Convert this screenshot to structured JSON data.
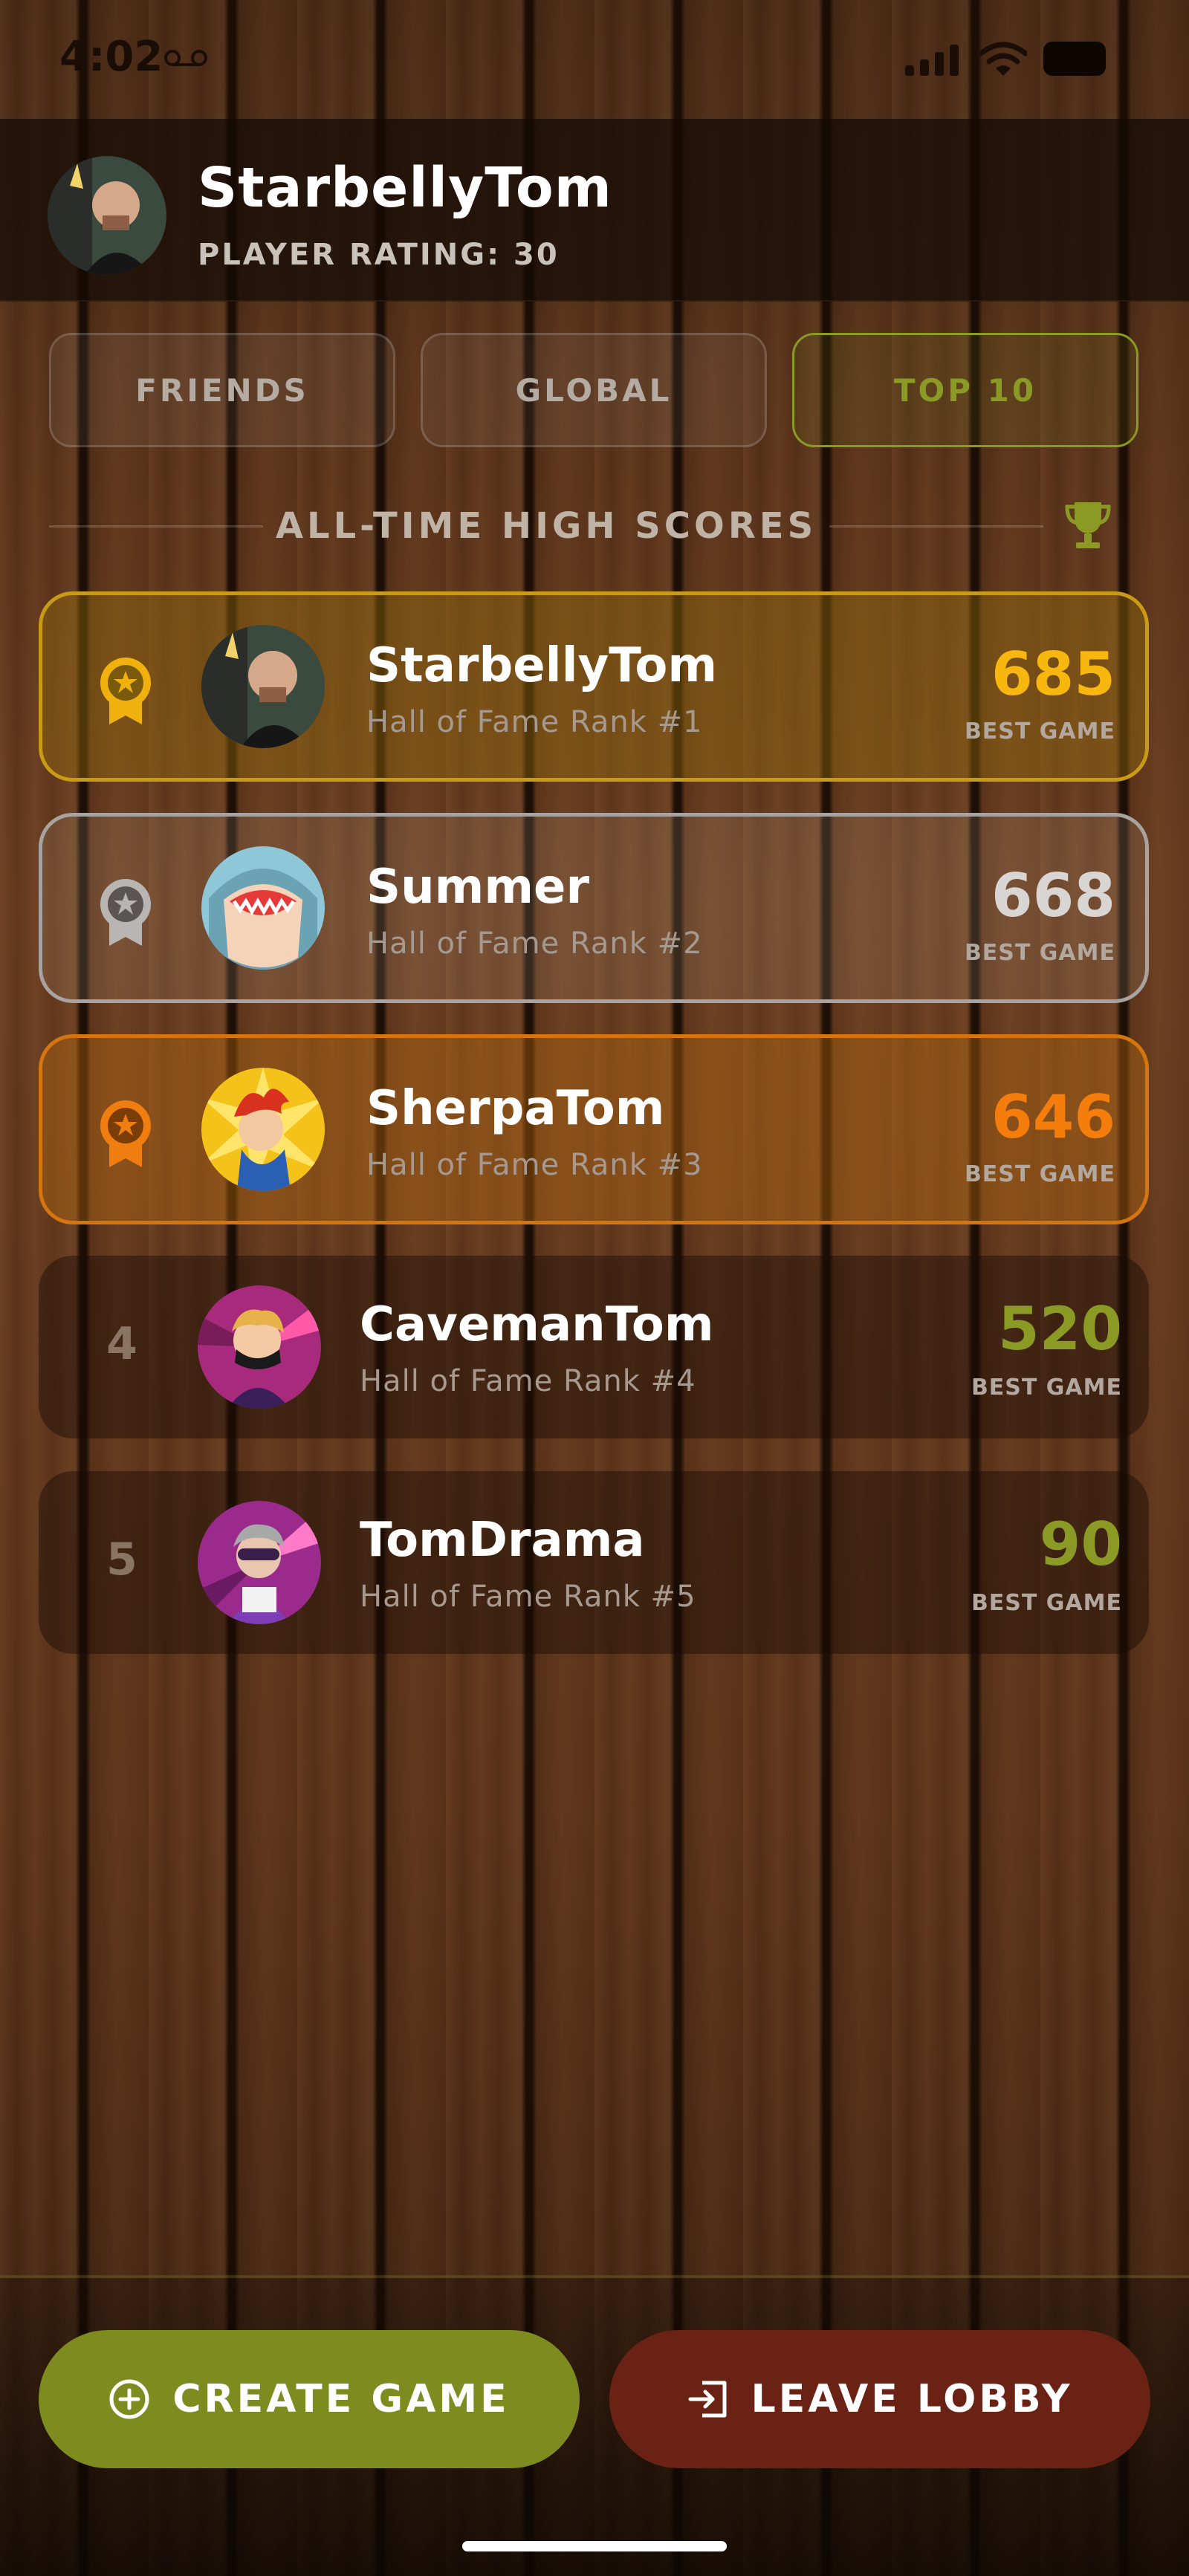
{
  "status_bar": {
    "time": "4:02"
  },
  "profile": {
    "name": "StarbellyTom",
    "rating": "PLAYER RATING: 30"
  },
  "tabs": [
    {
      "label": "FRIENDS",
      "active": false
    },
    {
      "label": "GLOBAL",
      "active": false
    },
    {
      "label": "TOP 10",
      "active": true
    }
  ],
  "section": {
    "title": "ALL-TIME HIGH SCORES",
    "icon": "trophy-icon"
  },
  "leaderboard": [
    {
      "rank": "1",
      "name": "StarbellyTom",
      "subtitle": "Hall of Fame Rank #1",
      "score": "685",
      "score_label": "BEST GAME",
      "medal": "gold",
      "score_color": "#f7b70f"
    },
    {
      "rank": "2",
      "name": "Summer",
      "subtitle": "Hall of Fame Rank #2",
      "score": "668",
      "score_label": "BEST GAME",
      "medal": "silver",
      "score_color": "#d9d5d2"
    },
    {
      "rank": "3",
      "name": "SherpaTom",
      "subtitle": "Hall of Fame Rank #3",
      "score": "646",
      "score_label": "BEST GAME",
      "medal": "bronze",
      "score_color": "#f57d0c"
    },
    {
      "rank": "4",
      "name": "CavemanTom",
      "subtitle": "Hall of Fame Rank #4",
      "score": "520",
      "score_label": "BEST GAME",
      "medal": "none",
      "score_color": "#8b9a25"
    },
    {
      "rank": "5",
      "name": "TomDrama",
      "subtitle": "Hall of Fame Rank #5",
      "score": "90",
      "score_label": "BEST GAME",
      "medal": "none",
      "score_color": "#8b9a25"
    }
  ],
  "actions": {
    "create_label": "CREATE GAME",
    "leave_label": "LEAVE LOBBY"
  },
  "colors": {
    "accent_green": "#7e8c1f",
    "leave_red": "#6a2214",
    "gold": "#c99a16",
    "silver": "#a8a3a0",
    "bronze": "#d4750f"
  }
}
